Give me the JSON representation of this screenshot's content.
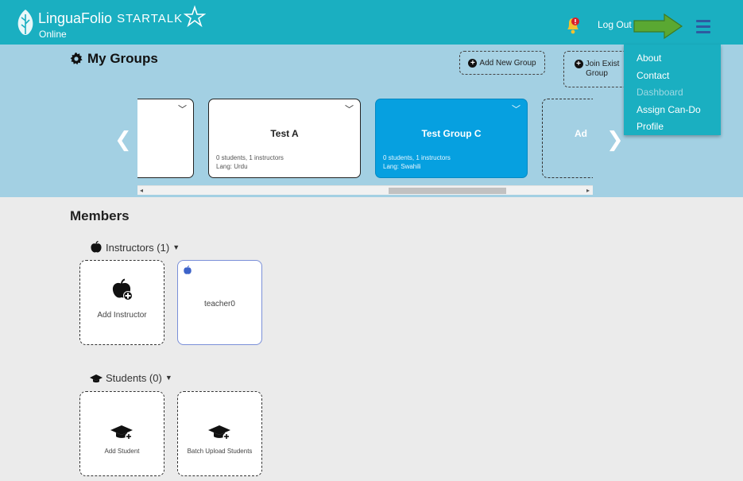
{
  "brand": {
    "name": "LinguaFolio",
    "sub": "Online",
    "partner": "STARTALK"
  },
  "header": {
    "logout": "Log Out"
  },
  "menu": {
    "items": [
      {
        "label": "About",
        "disabled": false
      },
      {
        "label": "Contact",
        "disabled": false
      },
      {
        "label": "Dashboard",
        "disabled": true
      },
      {
        "label": "Assign Can-Do",
        "disabled": false
      },
      {
        "label": "Profile",
        "disabled": false
      }
    ]
  },
  "groups": {
    "title": "My Groups",
    "add_group": "Add New Group",
    "join_group_line1": "Join Exist",
    "join_group_line2": "Group",
    "cards": [
      {
        "name": "",
        "stats": "",
        "lang": ""
      },
      {
        "name": "Test A",
        "stats": "0 students, 1 instructors",
        "lang": "Lang: Urdu"
      },
      {
        "name": "Test Group C",
        "stats": "0 students, 1 instructors",
        "lang": "Lang: Swahili"
      },
      {
        "name": "Ad"
      }
    ],
    "selected_index": 2
  },
  "members": {
    "title": "Members",
    "instructors_label": "Instructors (1)",
    "students_label": "Students (0)",
    "add_instructor": "Add Instructor",
    "teacher": "teacher0",
    "add_student": "Add Student",
    "batch_upload": "Batch Upload Students"
  },
  "colors": {
    "topbar": "#1aafc1",
    "panel": "#a3d0e3",
    "selected_card": "#06a0e0",
    "arrow": "#5aa832"
  }
}
